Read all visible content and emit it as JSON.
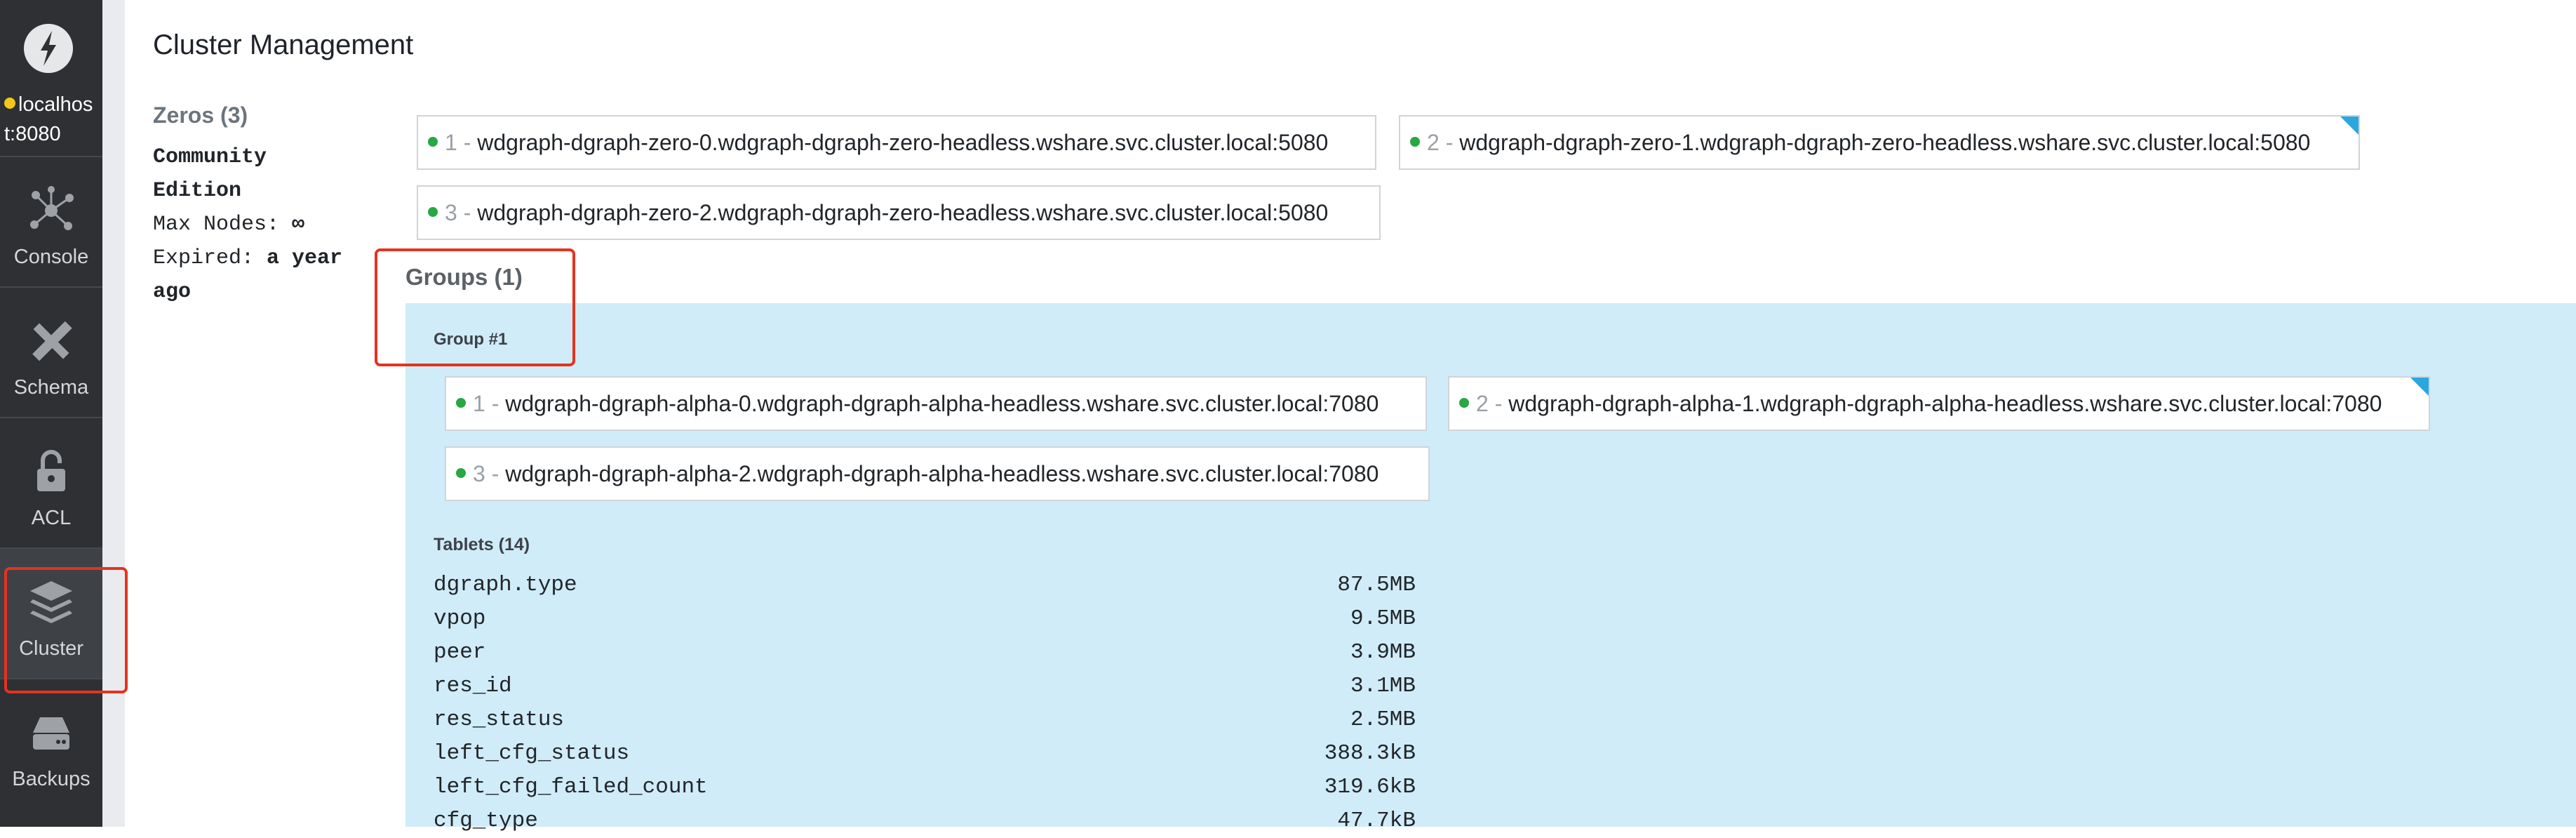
{
  "sidebar": {
    "server_line1": "localhos",
    "server_line2": "t:8080",
    "status_color": "#f5c518",
    "items": [
      {
        "label": "Console",
        "icon": "console-icon"
      },
      {
        "label": "Schema",
        "icon": "schema-icon"
      },
      {
        "label": "ACL",
        "icon": "unlock-icon"
      },
      {
        "label": "Cluster",
        "icon": "layers-icon",
        "active": true
      },
      {
        "label": "Backups",
        "icon": "drive-icon"
      }
    ]
  },
  "main": {
    "title": "Cluster Management",
    "zeros": {
      "title": "Zeros (3)",
      "license": {
        "edition_line1": "Community",
        "edition_line2": "Edition",
        "max_nodes_label": "Max Nodes: ",
        "max_nodes_value": "∞",
        "expired_label": "Expired: ",
        "expired_value_line1": "a year",
        "expired_value_line2": "ago"
      },
      "nodes": [
        {
          "index": "1 -",
          "address": "wdgraph-dgraph-zero-0.wdgraph-dgraph-zero-headless.wshare.svc.cluster.local:5080"
        },
        {
          "index": "2 -",
          "address": "wdgraph-dgraph-zero-1.wdgraph-dgraph-zero-headless.wshare.svc.cluster.local:5080"
        },
        {
          "index": "3 -",
          "address": "wdgraph-dgraph-zero-2.wdgraph-dgraph-zero-headless.wshare.svc.cluster.local:5080"
        }
      ]
    },
    "groups": {
      "title": "Groups (1)",
      "group": {
        "name": "Group #1",
        "nodes": [
          {
            "index": "1 -",
            "address": "wdgraph-dgraph-alpha-0.wdgraph-dgraph-alpha-headless.wshare.svc.cluster.local:7080"
          },
          {
            "index": "2 -",
            "address": "wdgraph-dgraph-alpha-1.wdgraph-dgraph-alpha-headless.wshare.svc.cluster.local:7080"
          },
          {
            "index": "3 -",
            "address": "wdgraph-dgraph-alpha-2.wdgraph-dgraph-alpha-headless.wshare.svc.cluster.local:7080"
          }
        ],
        "tablets_title": "Tablets (14)",
        "tablets": [
          {
            "name": "dgraph.type",
            "size": "87.5MB"
          },
          {
            "name": "vpop",
            "size": "9.5MB"
          },
          {
            "name": "peer",
            "size": "3.9MB"
          },
          {
            "name": "res_id",
            "size": "3.1MB"
          },
          {
            "name": "res_status",
            "size": "2.5MB"
          },
          {
            "name": "left_cfg_status",
            "size": "388.3kB"
          },
          {
            "name": "left_cfg_failed_count",
            "size": "319.6kB"
          },
          {
            "name": "cfg_type",
            "size": "47.7kB"
          }
        ]
      }
    }
  },
  "colors": {
    "sidebar_bg": "#2e3033",
    "group_panel_bg": "#d0ecf8",
    "healthy_dot": "#28a745",
    "leader_marker": "#2aa7e0",
    "highlight": "#e4331f"
  }
}
